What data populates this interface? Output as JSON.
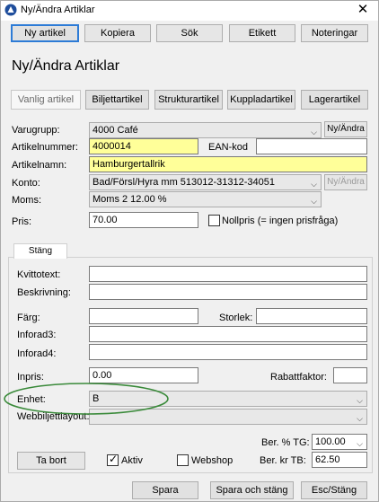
{
  "window": {
    "title": "Ny/Ändra Artiklar",
    "close_glyph": "✕"
  },
  "toolbar": {
    "ny_artikel": "Ny artikel",
    "kopiera": "Kopiera",
    "sok": "Sök",
    "etikett": "Etikett",
    "noteringar": "Noteringar"
  },
  "heading": "Ny/Ändra Artiklar",
  "article_types": {
    "vanlig": "Vanlig artikel",
    "biljett": "Biljettartikel",
    "struktur": "Strukturartikel",
    "kopplad": "Kuppladartikel",
    "lager": "Lagerartikel"
  },
  "form": {
    "varugrupp_label": "Varugrupp:",
    "varugrupp_value": "4000 Café",
    "ny_andra": "Ny/Ändra",
    "artikelnummer_label": "Artikelnummer:",
    "artikelnummer_value": "4000014",
    "ean_label": "EAN-kod",
    "ean_value": "",
    "artikelnamn_label": "Artikelnamn:",
    "artikelnamn_value": "Hamburgertallrik",
    "konto_label": "Konto:",
    "konto_value": "Bad/Försl/Hyra mm 513012-31312-34051",
    "ny_andra_disabled": "Ny/Ändra",
    "moms_label": "Moms:",
    "moms_value": "Moms 2 12.00 %",
    "pris_label": "Pris:",
    "pris_value": "70.00",
    "nollpris_label": "Nollpris (= ingen prisfråga)"
  },
  "panel": {
    "tab_label": "Stäng",
    "kvittotext_label": "Kvittotext:",
    "beskrivning_label": "Beskrivning:",
    "farg_label": "Färg:",
    "storlek_label": "Storlek:",
    "inforad3_label": "Inforad3:",
    "inforad4_label": "Inforad4:",
    "inpris_label": "Inpris:",
    "inpris_value": "0.00",
    "rabattfaktor_label": "Rabattfaktor:",
    "enhet_label": "Enhet:",
    "enhet_value": "B",
    "webbiljettlayout_label": "Webbiljettlayout:",
    "ber_tg_label": "Ber. % TG:",
    "ber_tg_value": "100.00",
    "ber_tb_label": "Ber. kr TB:",
    "ber_tb_value": "62.50",
    "ta_bort": "Ta bort",
    "aktiv_label": "Aktiv",
    "webshop_label": "Webshop",
    "check_glyph": "✓"
  },
  "footer": {
    "spara": "Spara",
    "spara_och_stang": "Spara och stäng",
    "esc_stang": "Esc/Stäng"
  },
  "colors": {
    "highlight_ellipse": "#3a8a3a",
    "required_field": "#ffff99",
    "primary_border": "#2d7bd6"
  }
}
